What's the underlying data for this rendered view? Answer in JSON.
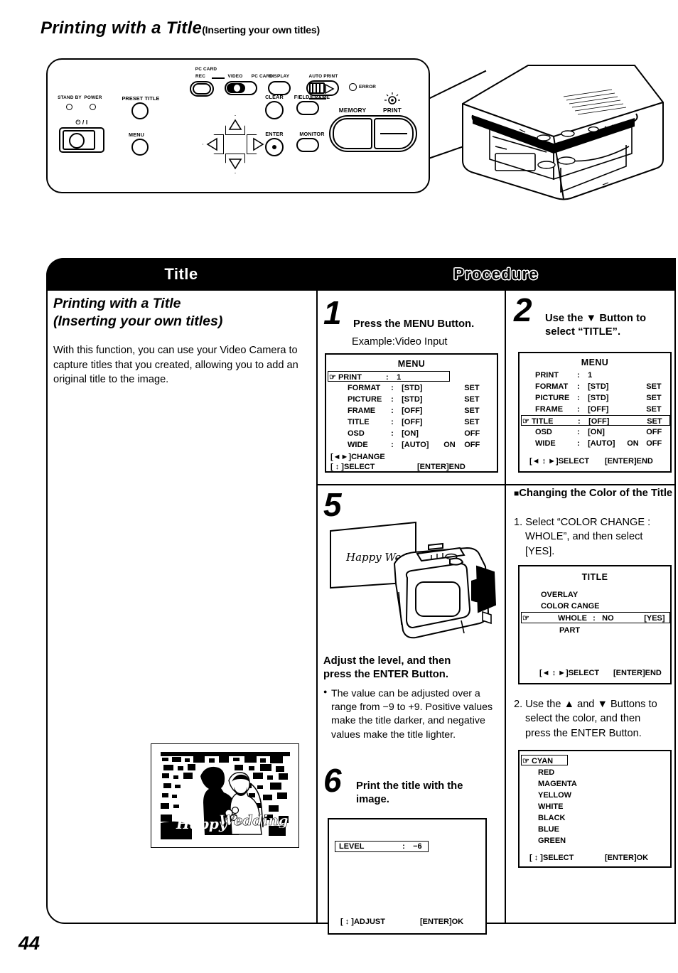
{
  "page": {
    "number": "44",
    "heading_main": "Printing with a Title",
    "heading_sub": "(Inserting your own titles)"
  },
  "control_panel": {
    "labels": {
      "stand_by": "STAND BY",
      "power": "POWER",
      "power_symbol": "⏻ / I",
      "preset_title": "PRESET TITLE",
      "menu": "MENU",
      "pc_card_top": "PC CARD",
      "rec": "REC",
      "video": "VIDEO",
      "pc_card": "PC CARD",
      "display": "DISPLAY",
      "auto_print": "AUTO PRINT",
      "error": "ERROR",
      "clear": "CLEAR",
      "enter": "ENTER",
      "field_frame": "FIELD/FRAME",
      "monitor": "MONITOR",
      "memory": "MEMORY",
      "print": "PRINT"
    }
  },
  "table": {
    "header": {
      "title_col": "Title",
      "procedure_col": "Procedure"
    },
    "left": {
      "heading_line1": "Printing with a Title",
      "heading_line2": "(Inserting your own titles)",
      "body": "With this function, you can use your Video Camera to capture titles that you created, allowing you to add an original title to the image.",
      "photo_caption": "Happy Wedding"
    },
    "steps": [
      {
        "number": "1",
        "instruction": "Press the MENU Button.",
        "example_label": "Example:Video Input",
        "screen": {
          "title": "MENU",
          "highlight_row": 0,
          "rows": [
            {
              "label": "PRINT",
              "sep": ":",
              "value": "1",
              "opt1": "",
              "opt2": ""
            },
            {
              "label": "FORMAT",
              "sep": ":",
              "value": "[STD]",
              "opt1": "",
              "opt2": "SET"
            },
            {
              "label": "PICTURE",
              "sep": ":",
              "value": "[STD]",
              "opt1": "",
              "opt2": "SET"
            },
            {
              "label": "FRAME",
              "sep": ":",
              "value": "[OFF]",
              "opt1": "",
              "opt2": "SET"
            },
            {
              "label": "TITLE",
              "sep": ":",
              "value": "[OFF]",
              "opt1": "",
              "opt2": "SET"
            },
            {
              "label": "OSD",
              "sep": ":",
              "value": "[ON]",
              "opt1": "",
              "opt2": "OFF"
            },
            {
              "label": "WIDE",
              "sep": ":",
              "value": "[AUTO]",
              "opt1": "ON",
              "opt2": "OFF"
            }
          ],
          "footer_line1": "[◄►]CHANGE",
          "footer_line2_left": "[ ↕ ]SELECT",
          "footer_line2_right": "[ENTER]END"
        }
      },
      {
        "number": "2",
        "instruction_line1": "Use the ▼ Button to",
        "instruction_line2": "select “TITLE”.",
        "screen": {
          "title": "MENU",
          "highlight_row": 4,
          "rows": [
            {
              "label": "PRINT",
              "sep": ":",
              "value": "1",
              "opt1": "",
              "opt2": ""
            },
            {
              "label": "FORMAT",
              "sep": ":",
              "value": "[STD]",
              "opt1": "",
              "opt2": "SET"
            },
            {
              "label": "PICTURE",
              "sep": ":",
              "value": "[STD]",
              "opt1": "",
              "opt2": "SET"
            },
            {
              "label": "FRAME",
              "sep": ":",
              "value": "[OFF]",
              "opt1": "",
              "opt2": "SET"
            },
            {
              "label": "TITLE",
              "sep": ":",
              "value": "[OFF]",
              "opt1": "",
              "opt2": "SET"
            },
            {
              "label": "OSD",
              "sep": ":",
              "value": "[ON]",
              "opt1": "",
              "opt2": "OFF"
            },
            {
              "label": "WIDE",
              "sep": ":",
              "value": "[AUTO]",
              "opt1": "ON",
              "opt2": "OFF"
            }
          ],
          "footer_left": "[◄ ↕ ►]SELECT",
          "footer_right": "[ENTER]END"
        }
      },
      {
        "number": "5",
        "card_text": "Happy Wedding",
        "instruction_line1": "Adjust the level, and then",
        "instruction_line2": "press the ENTER Button.",
        "note": "The value can be adjusted over a range from −9 to +9. Positive values make the title darker, and negative values make the title lighter."
      },
      {
        "number": "6",
        "instruction_line1": "Print the title with the",
        "instruction_line2": "image.",
        "screen": {
          "level_label": "LEVEL",
          "level_sep": ":",
          "level_value": "−6",
          "footer_left": "[ ↕ ]ADJUST",
          "footer_right": "[ENTER]OK"
        }
      }
    ],
    "color_section": {
      "heading": "Changing the Color of the Title",
      "item1_line1": "1. Select “COLOR CHANGE :",
      "item1_line2": "WHOLE”, and then select",
      "item1_line3": "[YES].",
      "title_screen": {
        "title": "TITLE",
        "rows": [
          "OVERLAY",
          "COLOR CANGE"
        ],
        "whole_label": "WHOLE",
        "whole_sep": ":",
        "whole_no": "NO",
        "whole_yes": "[YES]",
        "part_label": "PART",
        "footer_left": "[◄ ↕ ►]SELECT",
        "footer_right": "[ENTER]END"
      },
      "item2_line1": "2. Use the ▲ and ▼ Buttons to",
      "item2_line2": "select the color, and then",
      "item2_line3": "press the ENTER Button.",
      "color_screen": {
        "selected": "CYAN",
        "colors": [
          "RED",
          "MAGENTA",
          "YELLOW",
          "WHITE",
          "BLACK",
          "BLUE",
          "GREEN"
        ],
        "footer_left": "[ ↕ ]SELECT",
        "footer_right": "[ENTER]OK"
      }
    }
  }
}
